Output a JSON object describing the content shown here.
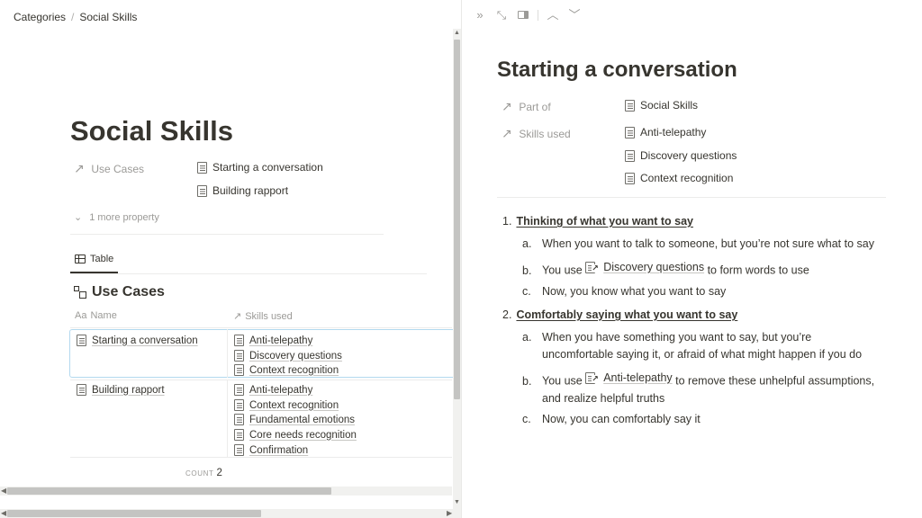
{
  "breadcrumb": {
    "items": [
      "Categories",
      "Social Skills"
    ],
    "separator": "/"
  },
  "page": {
    "title": "Social Skills",
    "properties": [
      {
        "name": "Use Cases",
        "icon": "arrow-up-right-icon",
        "values": [
          "Starting a conversation",
          "Building rapport"
        ]
      }
    ],
    "more_property": "1 more property"
  },
  "view": {
    "tab_label": "Table"
  },
  "database": {
    "title": "Use Cases",
    "columns": [
      {
        "label": "Name",
        "icon_text": "Aa"
      },
      {
        "label": "Skills used",
        "icon": "arrow-up-right-icon"
      }
    ],
    "rows": [
      {
        "name": "Starting a conversation",
        "skills": [
          "Anti-telepathy",
          "Discovery questions",
          "Context recognition"
        ]
      },
      {
        "name": "Building rapport",
        "skills": [
          "Anti-telepathy",
          "Context recognition",
          "Fundamental emotions",
          "Core needs recognition",
          "Confirmation"
        ]
      }
    ],
    "count_label": "COUNT",
    "count_value": "2"
  },
  "peek": {
    "toolbar": [
      "double-chevron-right-icon",
      "expand-icon",
      "side-panel-icon",
      "chevron-up-icon",
      "chevron-down-icon"
    ],
    "title": "Starting a conversation",
    "properties": [
      {
        "name": "Part of",
        "values": [
          "Social Skills"
        ]
      },
      {
        "name": "Skills used",
        "values": [
          "Anti-telepathy",
          "Discovery questions",
          "Context recognition"
        ]
      }
    ],
    "content": [
      {
        "number": "1.",
        "heading": "Thinking of what you want to say",
        "items": [
          {
            "marker": "a.",
            "text": "When you want to talk to someone, but you’re not sure what to say"
          },
          {
            "marker": "b.",
            "before": "You use",
            "mention": "Discovery questions",
            "after": "to form words to use"
          },
          {
            "marker": "c.",
            "text": "Now, you know what you want to say"
          }
        ]
      },
      {
        "number": "2.",
        "heading": "Comfortably saying what you want to say",
        "items": [
          {
            "marker": "a.",
            "line1": "When you have something you want to say, but you’re",
            "line2": "uncomfortable saying it, or afraid of what might happen if you do"
          },
          {
            "marker": "b.",
            "before": "You use",
            "mention": "Anti-telepathy",
            "after": "to remove these unhelpful assumptions,",
            "line2": "and realize helpful truths"
          },
          {
            "marker": "c.",
            "text": "Now, you can comfortably say it"
          }
        ]
      }
    ]
  },
  "colors": {
    "text": "#37352f",
    "muted": "#9b9a97",
    "selection_border": "#b3d9ef",
    "divider": "#ececeb"
  }
}
